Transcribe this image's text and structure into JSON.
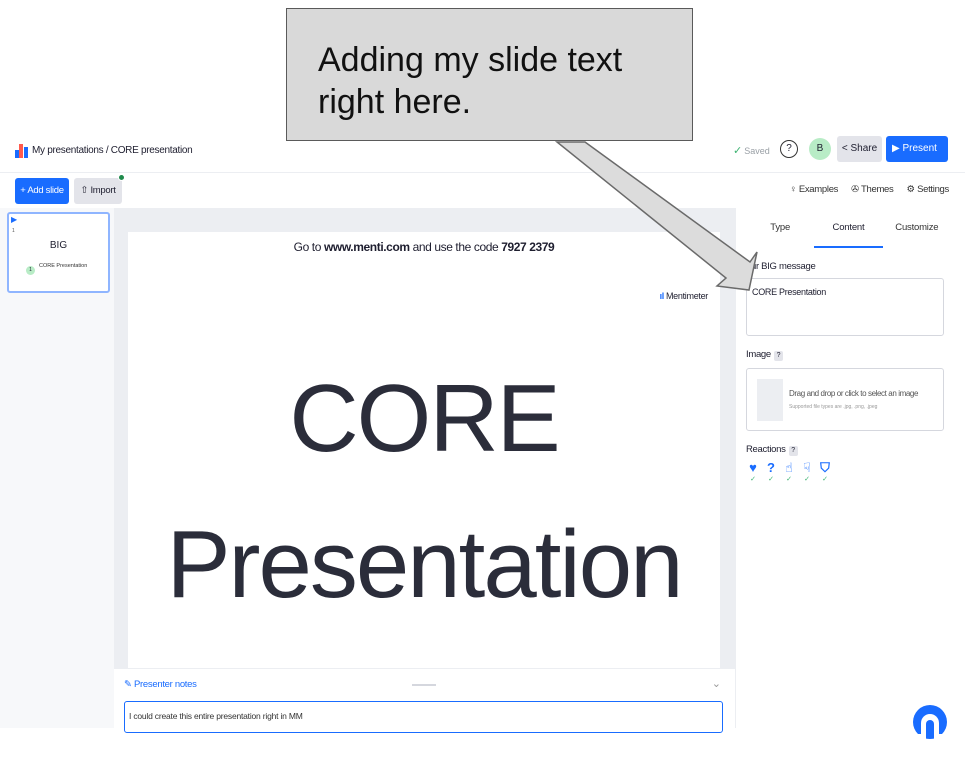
{
  "callout": {
    "line1": "Adding my slide text",
    "line2": "right here."
  },
  "header": {
    "breadcrumb": "My presentations / CORE presentation",
    "saved_label": "Saved",
    "help_icon": "question-icon",
    "avatar_initial": "B",
    "share_label": "Share",
    "present_label": "Present"
  },
  "toolbar": {
    "add_slide_label": "+ Add slide",
    "import_label": "Import",
    "examples_label": "Examples",
    "themes_label": "Themes",
    "settings_label": "Settings"
  },
  "slides": [
    {
      "number": "1",
      "title": "BIG",
      "subtitle": "CORE Presentation",
      "badge": "1"
    }
  ],
  "slide": {
    "code_prefix": "Go to ",
    "url": "www.menti.com",
    "code_middle": " and use the code ",
    "code": "7927 2379",
    "brand": "Mentimeter",
    "big_line1": "CORE",
    "big_line2": "Presentation"
  },
  "notes": {
    "label": "Presenter notes",
    "value": "I could create this entire presentation right in MM"
  },
  "panel": {
    "tabs": [
      "Type",
      "Content",
      "Customize"
    ],
    "active_tab": "Content",
    "message_label": "our BIG message",
    "message_value": "CORE Presentation",
    "image_label": "Image",
    "image_hint": "Drag and drop or click to select an image",
    "image_sub": "Supported file types are .jpg, .png, .jpeg",
    "reactions_label": "Reactions",
    "reactions": [
      "heart-icon",
      "question-mark-icon",
      "thumbs-up-icon",
      "thumbs-down-icon",
      "shield-icon"
    ]
  },
  "colors": {
    "accent": "#196cff",
    "saved_green": "#3cb371",
    "callout_bg": "#d9d9d9"
  }
}
